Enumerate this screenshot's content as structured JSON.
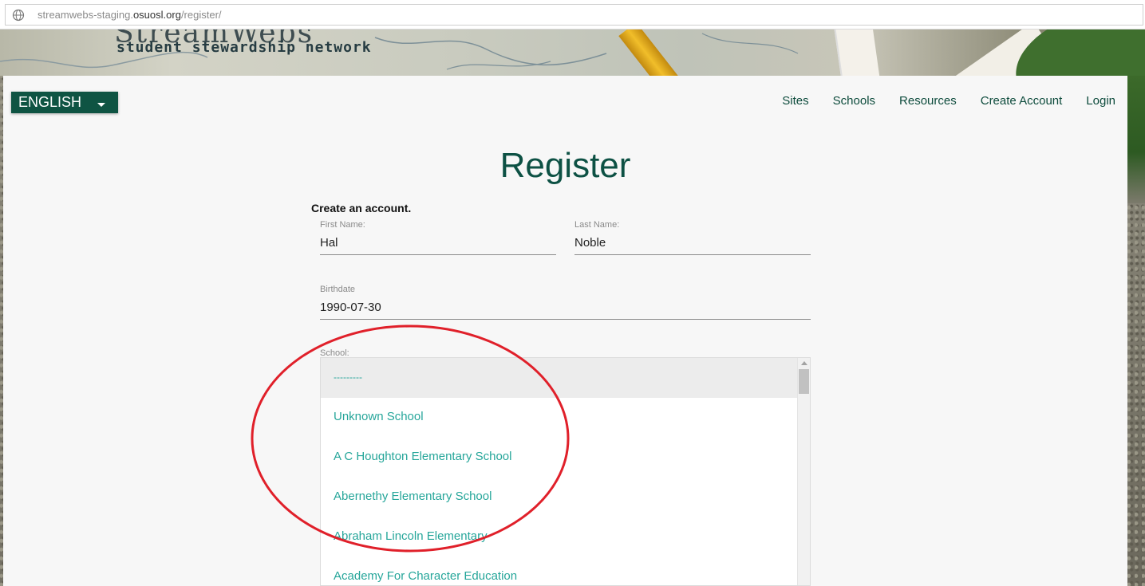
{
  "browser": {
    "url_prefix": "streamwebs-staging.",
    "url_host": "osuosl.org",
    "url_path": "/register/"
  },
  "banner": {
    "brand_name": "StreamWebs",
    "tagline": "student stewardship network"
  },
  "language": {
    "selected": "ENGLISH"
  },
  "nav": {
    "sites": "Sites",
    "schools": "Schools",
    "resources": "Resources",
    "create_account": "Create Account",
    "login": "Login"
  },
  "page": {
    "title": "Register",
    "subtitle": "Create an account."
  },
  "form": {
    "first_name": {
      "label": "First Name:",
      "value": "Hal"
    },
    "last_name": {
      "label": "Last Name:",
      "value": "Noble"
    },
    "birthdate": {
      "label": "Birthdate",
      "value": "1990-07-30"
    },
    "school": {
      "label": "School:",
      "options": [
        "---------",
        "Unknown School",
        "A C Houghton Elementary School",
        "Abernethy Elementary School",
        "Abraham Lincoln Elementary",
        "Academy For Character Education"
      ]
    }
  },
  "colors": {
    "brand_green": "#0f5443",
    "option_teal": "#26a69a",
    "annotation_red": "#e0202a"
  }
}
